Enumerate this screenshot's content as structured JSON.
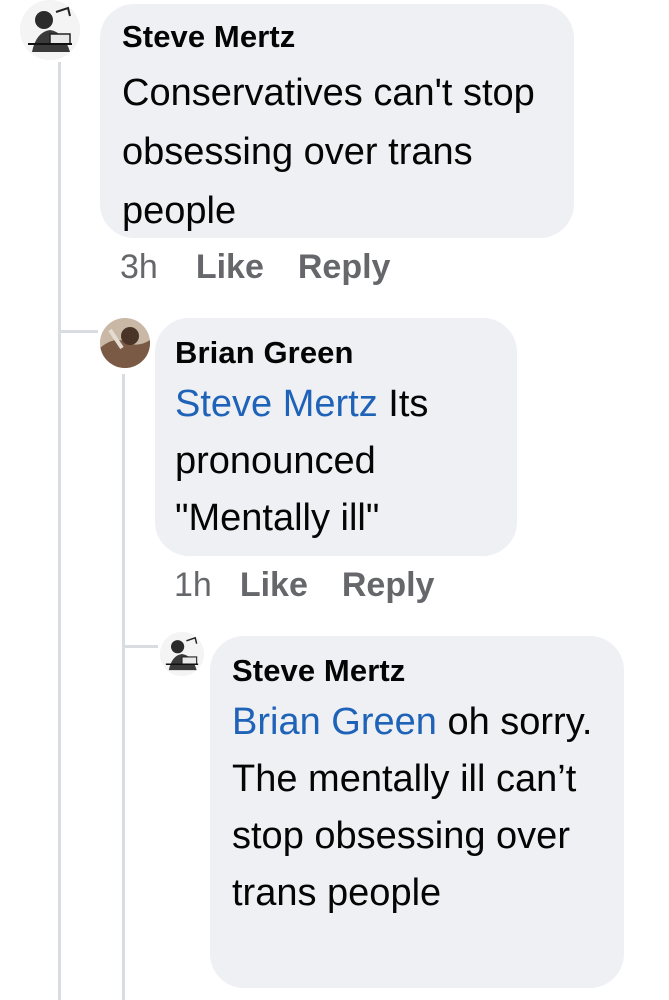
{
  "comments": [
    {
      "author": "Steve Mertz",
      "mention": "",
      "text": "Conservatives can't stop obsessing over trans people",
      "time": "3h",
      "like_label": "Like",
      "reply_label": "Reply"
    },
    {
      "author": "Brian Green",
      "mention": "Steve Mertz",
      "text": " Its pronounced \"Mentally ill\"",
      "time": "1h",
      "like_label": "Like",
      "reply_label": "Reply"
    },
    {
      "author": "Steve Mertz",
      "mention": "Brian Green",
      "text": " oh sorry. The mentally ill can’t stop obsessing over trans people"
    }
  ]
}
